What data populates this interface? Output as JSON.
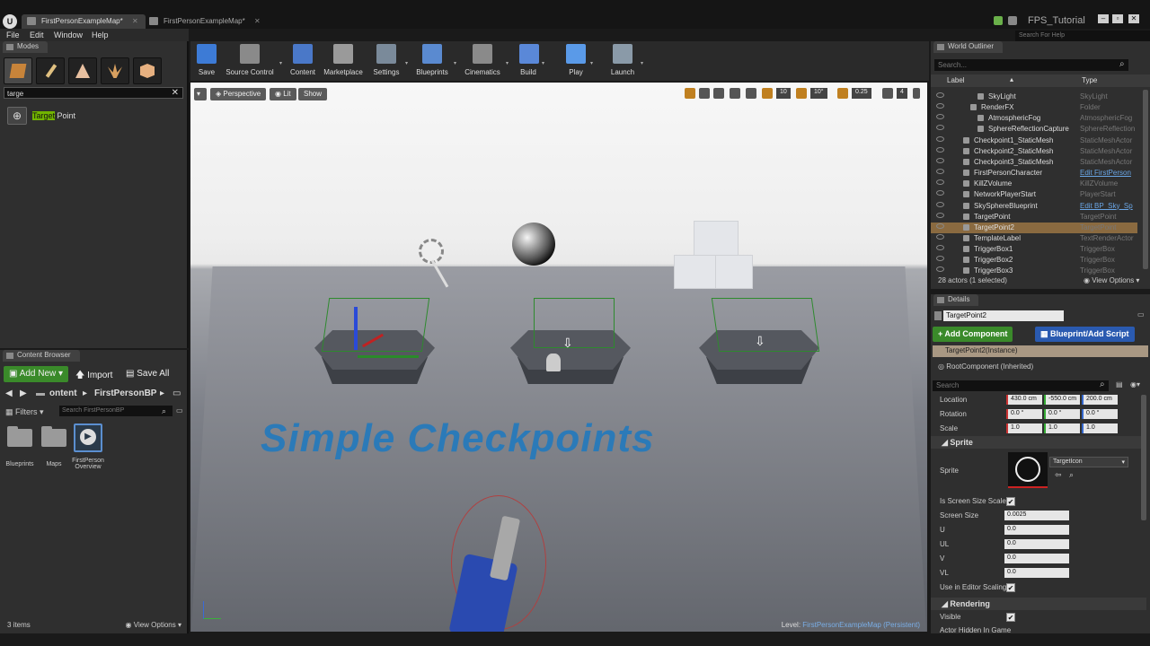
{
  "titlebar": {
    "logo": "U",
    "tabs": [
      {
        "label": "FirstPersonExampleMap*",
        "active": true
      },
      {
        "label": "FirstPersonExampleMap*",
        "active": false
      }
    ],
    "project_name": "FPS_Tutorial",
    "window_controls": [
      "–",
      "▫",
      "✕"
    ]
  },
  "menu": [
    "File",
    "Edit",
    "Window",
    "Help"
  ],
  "help_search_placeholder": "Search For Help",
  "modes": {
    "tab_label": "Modes",
    "mode_icons": [
      "place-icon",
      "paint-icon",
      "landscape-icon",
      "foliage-icon",
      "geometry-icon"
    ],
    "search_value": "targe",
    "result": {
      "prefix": "Target",
      "rest": " Point"
    }
  },
  "content_browser": {
    "tab_label": "Content Browser",
    "add_new": "Add New",
    "import": "Import",
    "save_all": "Save All",
    "path": [
      "ontent",
      "FirstPersonBP"
    ],
    "filters": "Filters",
    "search_placeholder": "Search FirstPersonBP",
    "items": [
      "Blueprints",
      "Maps",
      "FirstPerson Overview"
    ],
    "item_count": "3 items",
    "view_options": "View Options"
  },
  "toolbar": [
    {
      "label": "Save",
      "color": "#3d7bd6"
    },
    {
      "label": "Source Control",
      "color": "#8a8a8a"
    },
    {
      "label": "Content",
      "color": "#4a78c8"
    },
    {
      "label": "Marketplace",
      "color": "#9a9a9a"
    },
    {
      "label": "Settings",
      "color": "#7a8a9a"
    },
    {
      "label": "Blueprints",
      "color": "#5a8ad0"
    },
    {
      "label": "Cinematics",
      "color": "#8a8a8a"
    },
    {
      "label": "Build",
      "color": "#5a88d8"
    },
    {
      "label": "Play",
      "color": "#5a9ae8"
    },
    {
      "label": "Launch",
      "color": "#8a9aa8"
    }
  ],
  "viewport": {
    "perspective": "Perspective",
    "lit": "Lit",
    "show": "Show",
    "grid_snap": "10",
    "rotation_snap": "10°",
    "scale_snap": "0.25",
    "camera_speed": "4",
    "title_text": "Simple Checkpoints",
    "level_label": "Level:",
    "level_name": "FirstPersonExampleMap (Persistent)"
  },
  "outliner": {
    "tab_label": "World Outliner",
    "search_placeholder": "Search...",
    "col_label": "Label",
    "col_type": "Type",
    "rows": [
      {
        "label": "SkyLight",
        "type": "SkyLight",
        "indent": 2,
        "link": false,
        "selected": false
      },
      {
        "label": "RenderFX",
        "type": "Folder",
        "indent": 1,
        "link": false,
        "selected": false
      },
      {
        "label": "AtmosphericFog",
        "type": "AtmosphericFog",
        "indent": 2,
        "link": false,
        "selected": false
      },
      {
        "label": "SphereReflectionCapture",
        "type": "SphereReflection",
        "indent": 2,
        "link": false,
        "selected": false
      },
      {
        "label": "Checkpoint1_StaticMesh",
        "type": "StaticMeshActor",
        "indent": 0,
        "link": false,
        "selected": false
      },
      {
        "label": "Checkpoint2_StaticMesh",
        "type": "StaticMeshActor",
        "indent": 0,
        "link": false,
        "selected": false
      },
      {
        "label": "Checkpoint3_StaticMesh",
        "type": "StaticMeshActor",
        "indent": 0,
        "link": false,
        "selected": false
      },
      {
        "label": "FirstPersonCharacter",
        "type": "Edit FirstPerson",
        "indent": 0,
        "link": true,
        "selected": false
      },
      {
        "label": "KillZVolume",
        "type": "KillZVolume",
        "indent": 0,
        "link": false,
        "selected": false
      },
      {
        "label": "NetworkPlayerStart",
        "type": "PlayerStart",
        "indent": 0,
        "link": false,
        "selected": false
      },
      {
        "label": "SkySphereBlueprint",
        "type": "Edit BP_Sky_Sp",
        "indent": 0,
        "link": true,
        "selected": false
      },
      {
        "label": "TargetPoint",
        "type": "TargetPoint",
        "indent": 0,
        "link": false,
        "selected": false
      },
      {
        "label": "TargetPoint2",
        "type": "TargetPoint",
        "indent": 0,
        "link": false,
        "selected": true
      },
      {
        "label": "TemplateLabel",
        "type": "TextRenderActor",
        "indent": 0,
        "link": false,
        "selected": false
      },
      {
        "label": "TriggerBox1",
        "type": "TriggerBox",
        "indent": 0,
        "link": false,
        "selected": false
      },
      {
        "label": "TriggerBox2",
        "type": "TriggerBox",
        "indent": 0,
        "link": false,
        "selected": false
      },
      {
        "label": "TriggerBox3",
        "type": "TriggerBox",
        "indent": 0,
        "link": false,
        "selected": false
      }
    ],
    "actor_count": "28 actors (1 selected)",
    "view_options": "View Options"
  },
  "details": {
    "tab_label": "Details",
    "object_name": "TargetPoint2",
    "add_component": "+ Add Component",
    "blueprint_script": "Blueprint/Add Script",
    "instance": "TargetPoint2(Instance)",
    "root_component": "RootComponent (Inherited)",
    "search_placeholder": "Search",
    "location": {
      "label": "Location",
      "x": "430.0 cm",
      "y": "-550.0 cm",
      "z": "200.0 cm"
    },
    "rotation": {
      "label": "Rotation",
      "x": "0.0 °",
      "y": "0.0 °",
      "z": "0.0 °"
    },
    "scale": {
      "label": "Scale",
      "x": "1.0",
      "y": "1.0",
      "z": "1.0"
    },
    "sprite_section": "Sprite",
    "sprite_label": "Sprite",
    "sprite_asset": "TargetIcon",
    "is_screen_size_scale": "Is Screen Size Scale",
    "screen_size_label": "Screen Size",
    "screen_size": "0.0025",
    "u_label": "U",
    "u": "0.0",
    "ul_label": "UL",
    "ul": "0.0",
    "v_label": "V",
    "v": "0.0",
    "vl_label": "VL",
    "vl": "0.0",
    "use_editor_scaling": "Use in Editor Scaling",
    "rendering_section": "Rendering",
    "visible": "Visible",
    "actor_hidden": "Actor Hidden In Game",
    "checkmark": "✔"
  }
}
